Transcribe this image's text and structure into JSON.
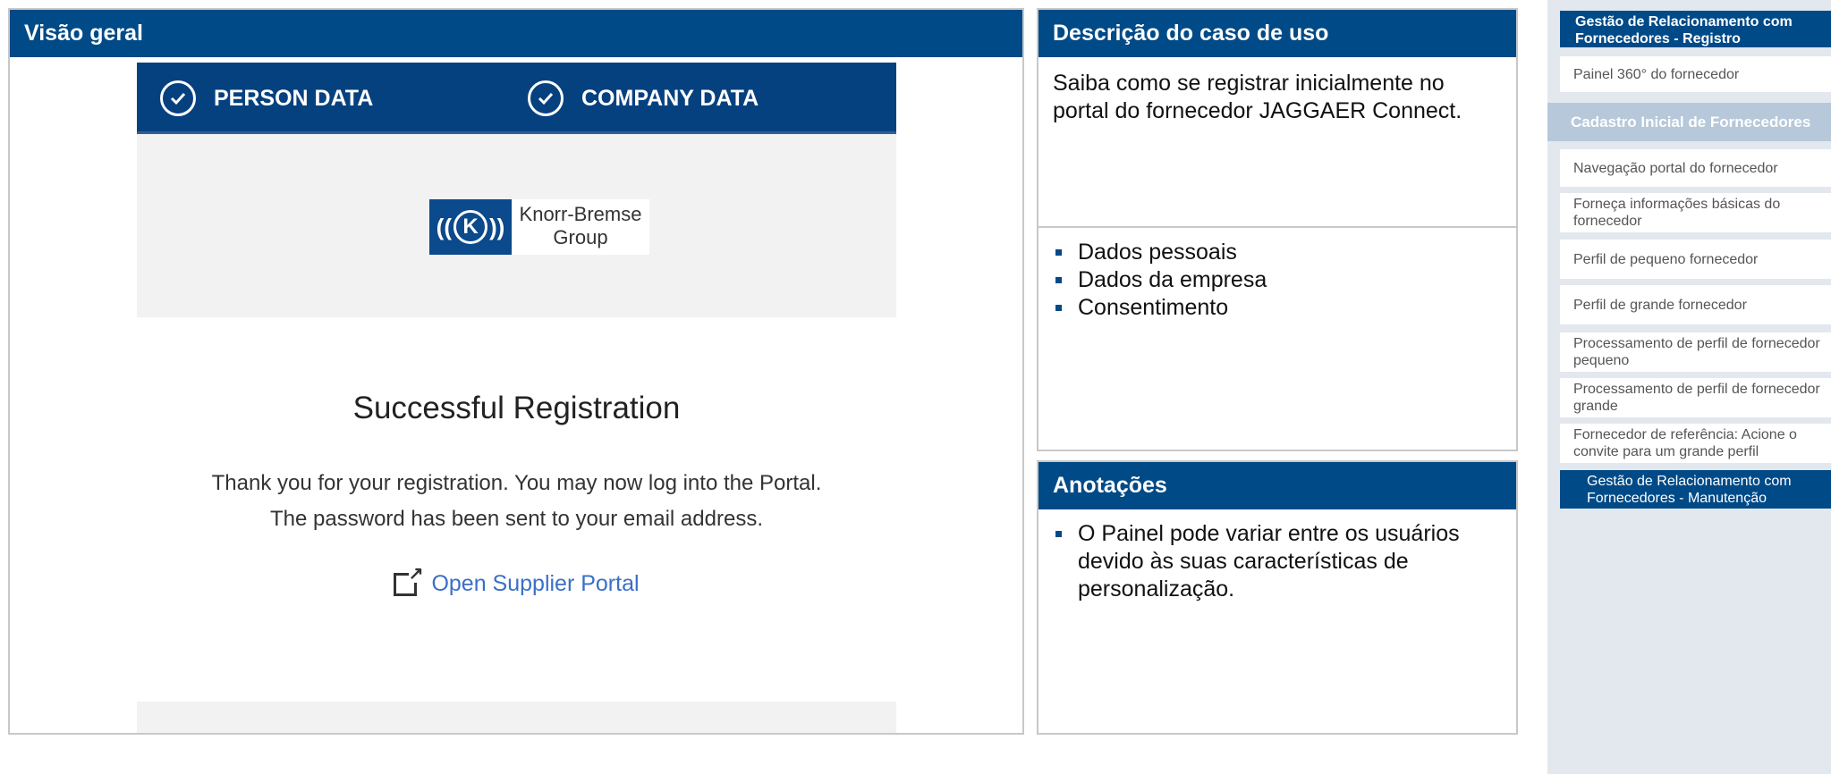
{
  "overview": {
    "title": "Visão geral",
    "screenshot": {
      "steps": [
        "PERSON DATA",
        "COMPANY DATA"
      ],
      "logo_text_line1": "Knorr-Bremse",
      "logo_text_line2": "Group",
      "success_title": "Successful Registration",
      "message_line1": "Thank you for your registration. You may now log into the Portal.",
      "message_line2": "The password has been sent to your email address.",
      "open_portal_link": "Open Supplier Portal"
    }
  },
  "usecase": {
    "title": "Descrição do caso de uso",
    "description": "Saiba como se registrar inicialmente no portal do fornecedor JAGGAER Connect.",
    "bullets": [
      "Dados pessoais",
      "Dados da empresa",
      "Consentimento"
    ]
  },
  "notes": {
    "title": "Anotações",
    "bullets": [
      "O Painel pode variar entre os usuários devido às suas características de personalização."
    ]
  },
  "sidebar": {
    "top": "Gestão de Relacionamento com Fornecedores - Registro",
    "item_360": "Painel 360° do fornecedor",
    "section": "Cadastro Inicial de Fornecedores",
    "items": [
      "Navegação portal do fornecedor",
      "Forneça informações básicas do fornecedor",
      "Perfil de pequeno fornecedor",
      "Perfil de grande fornecedor",
      "Processamento de perfil de fornecedor pequeno",
      "Processamento de perfil de fornecedor grande",
      "Fornecedor de referência: Acione o convite para um grande perfil"
    ],
    "bottom": "Gestão de Relacionamento com Fornecedores - Manutenção"
  }
}
